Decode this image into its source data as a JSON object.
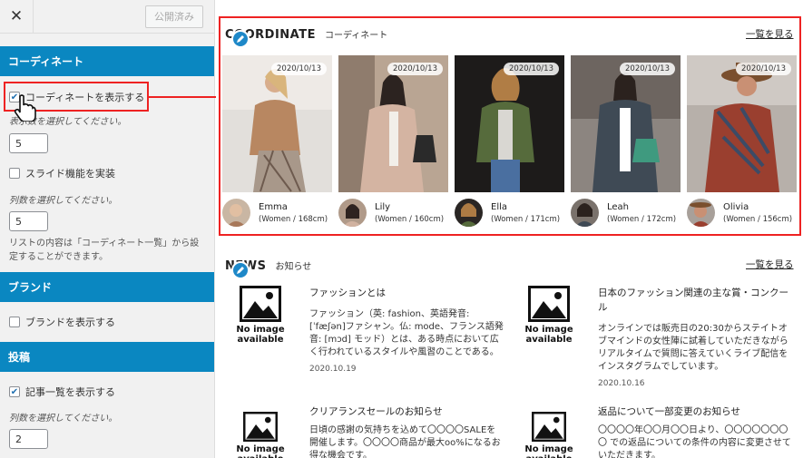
{
  "panel": {
    "close_glyph": "✕",
    "publish_label": "公開済み",
    "sections": {
      "coordinate": "コーディネート",
      "brand": "ブランド",
      "post": "投稿"
    },
    "coordinate": {
      "show_label": "コーディネートを表示する",
      "show_checked": true,
      "count_hint": "表示数を選択してください。",
      "count_value": "5",
      "slide_label": "スライド機能を実装",
      "slide_checked": false,
      "cols_hint": "列数を選択してください。",
      "cols_value": "5",
      "note": "リストの内容は「コーディネート一覧」から設定することができます。"
    },
    "brand": {
      "show_label": "ブランドを表示する",
      "show_checked": false
    },
    "post": {
      "show_label": "記事一覧を表示する",
      "show_checked": true,
      "cols_hint": "列数を選択してください。",
      "cols_value": "2"
    }
  },
  "coordinate": {
    "title": "COORDINATE",
    "subtitle": "コーディネート",
    "see_all": "一覧を見る",
    "cards": [
      {
        "date": "2020/10/13",
        "name": "Emma",
        "meta": "(Women / 168cm)"
      },
      {
        "date": "2020/10/13",
        "name": "Lily",
        "meta": "(Women / 160cm)"
      },
      {
        "date": "2020/10/13",
        "name": "Ella",
        "meta": "(Women / 171cm)"
      },
      {
        "date": "2020/10/13",
        "name": "Leah",
        "meta": "(Women / 172cm)"
      },
      {
        "date": "2020/10/13",
        "name": "Olivia",
        "meta": "(Women / 156cm)"
      }
    ]
  },
  "news": {
    "title": "NEWS",
    "subtitle": "お知らせ",
    "see_all": "一覧を見る",
    "no_image": "No image available",
    "items": [
      {
        "title": "ファッションとは",
        "excerpt": "ファッション（英: fashion、英語発音: [ˈfæʃən]ファシャン。仏: mode、フランス語発音: [mɔd] モッド）とは、ある時点において広く行われているスタイルや風習のことである。",
        "date": "2020.10.19"
      },
      {
        "title": "日本のファッション関連の主な賞・コンクール",
        "excerpt": "オンラインでは販売日の20:30からステイトオブマインドの女性陣に試着していただきながらリアルタイムで質問に答えていくライブ配信をインスタグラムでしています。",
        "date": "2020.10.16"
      },
      {
        "title": "クリアランスセールのお知らせ",
        "excerpt": "日頃の感謝の気持ちを込めて〇〇〇〇SALEを開催します。〇〇〇〇商品が最大oo%になるお得な機会です。",
        "date": ""
      },
      {
        "title": "返品について一部変更のお知らせ",
        "excerpt": "〇〇〇〇年〇〇月〇〇日より、〇〇〇〇〇〇〇〇 での返品についての条件の内容に変更させていただきます。",
        "date": ""
      }
    ]
  }
}
